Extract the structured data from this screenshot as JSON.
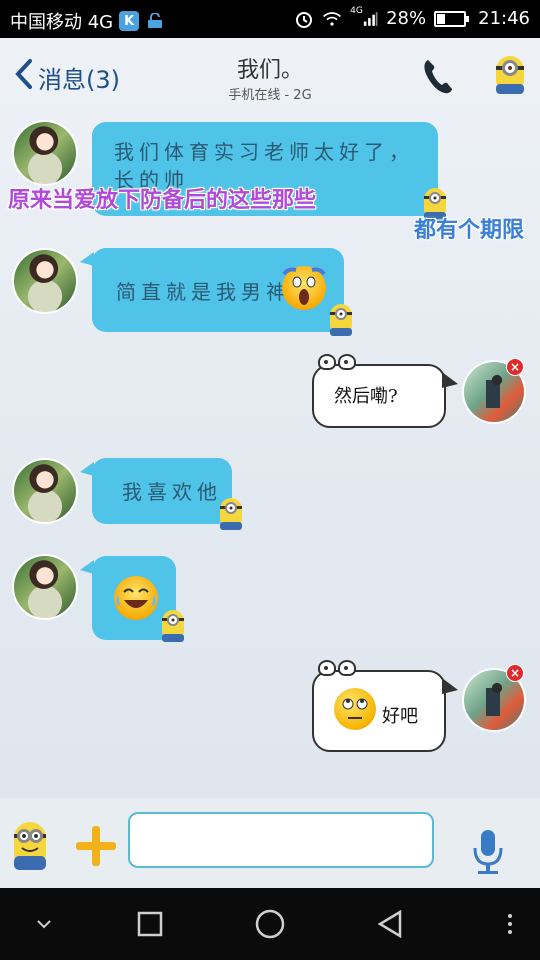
{
  "status_bar": {
    "carrier": "中国移动 4G",
    "battery_percent": "28%",
    "battery_level": 0.28,
    "time": "21:46",
    "network_label": "4G"
  },
  "header": {
    "back_label": "消息(3)",
    "title": "我们。",
    "subtitle": "手机在线 - 2G"
  },
  "messages": [
    {
      "side": "left",
      "text": "我们体育实习老师太好了，长的帅"
    },
    {
      "side": "left",
      "text": "简直就是我男神"
    },
    {
      "side": "right",
      "text": "然后嘞?"
    },
    {
      "side": "left",
      "text": "我喜欢他"
    },
    {
      "side": "left",
      "text": ""
    },
    {
      "side": "right",
      "text": "好吧"
    }
  ],
  "captions": {
    "line1": "原来当爱放下防备后的这些那些",
    "line2": "都有个期限"
  },
  "input": {
    "placeholder": "",
    "value": ""
  },
  "colors": {
    "bubble_left": "#4fc3e8",
    "bubble_right_border": "#333333",
    "header_text": "#1f4f8a",
    "caption_purple": "#b04ad9",
    "caption_blue": "#3c7fd6",
    "plus_button": "#f2b21a"
  },
  "icons": {
    "back": "chevron-left-icon",
    "call": "phone-icon",
    "voice": "microphone-icon",
    "more": "plus-icon"
  }
}
